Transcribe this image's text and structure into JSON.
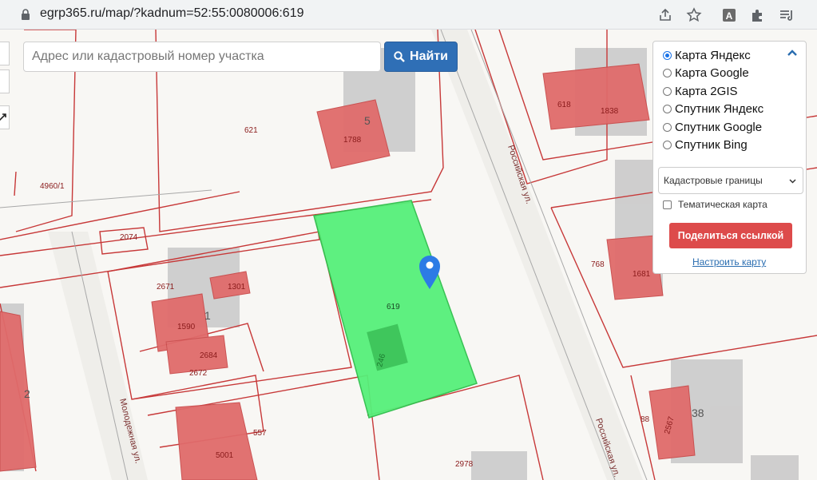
{
  "browser": {
    "url": "egrp365.ru/map/?kadnum=52:55:0080006:619",
    "icons": [
      "lock-icon",
      "share-icon",
      "star-icon",
      "extension-a-icon",
      "puzzle-icon",
      "playlist-icon"
    ]
  },
  "search": {
    "placeholder": "Адрес или кадастровый номер участка",
    "button_label": "Найти"
  },
  "layers_panel": {
    "options": [
      {
        "label": "Карта Яндекс",
        "selected": true
      },
      {
        "label": "Карта Google",
        "selected": false
      },
      {
        "label": "Карта 2GIS",
        "selected": false
      },
      {
        "label": "Спутник Яндекс",
        "selected": false
      },
      {
        "label": "Спутник Google",
        "selected": false
      },
      {
        "label": "Спутник Bing",
        "selected": false
      }
    ],
    "boundaries_select": "Кадастровые границы",
    "thematic_label": "Тематическая карта",
    "thematic_checked": false,
    "share_label": "Поделиться ссылкой",
    "configure_label": "Настроить карту"
  },
  "map": {
    "selected_parcel": "619",
    "parcel_labels": [
      "621",
      "4960/1",
      "2074",
      "2671",
      "1301",
      "1590",
      "2684",
      "2672",
      "557",
      "5001",
      "2978",
      "618",
      "768",
      "88",
      "1788",
      "1838",
      "1681",
      "2567",
      "246"
    ],
    "building_numbers": [
      "5",
      "1",
      "2",
      "38"
    ],
    "street_labels": [
      "Российская ул.",
      "Российская ул.",
      "Молодежная ул."
    ],
    "colors": {
      "selected": "#56f07a",
      "building": "#e06b6b",
      "boundary": "#c73838"
    }
  }
}
